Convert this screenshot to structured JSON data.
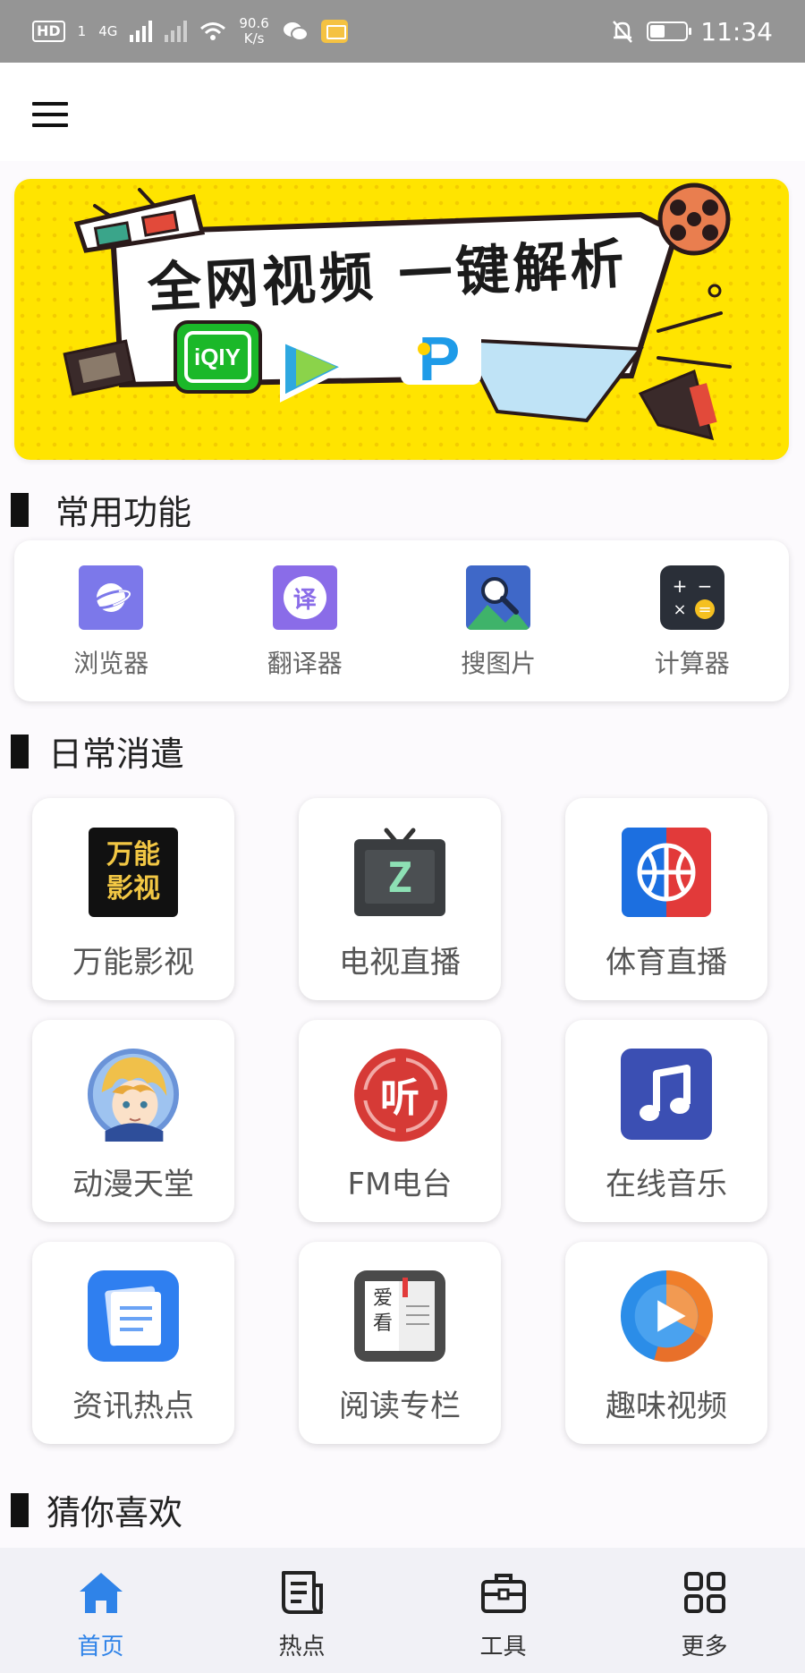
{
  "status_bar": {
    "hd": "HD",
    "hd_sub": "1",
    "network": "4G",
    "speed_value": "90.6",
    "speed_unit": "K/s",
    "time": "11:34",
    "icons": [
      "hd-icon",
      "signal-icon",
      "wifi-icon",
      "wechat-icon",
      "mail-icon",
      "mute-bell-icon",
      "battery-icon"
    ]
  },
  "top_bar": {
    "menu_icon": "hamburger-menu-icon"
  },
  "banner": {
    "title": "全网视频 一键解析"
  },
  "sections": {
    "common": "常用功能",
    "daily": "日常消遣",
    "guess": "猜你喜欢"
  },
  "common_functions": [
    {
      "label": "浏览器",
      "icon": "browser-icon"
    },
    {
      "label": "翻译器",
      "icon": "translate-icon",
      "glyph": "译"
    },
    {
      "label": "搜图片",
      "icon": "image-search-icon"
    },
    {
      "label": "计算器",
      "icon": "calculator-icon"
    }
  ],
  "daily_apps": [
    {
      "label": "万能影视",
      "icon": "movie-app-icon",
      "glyph_top": "万能",
      "glyph_bottom": "影视"
    },
    {
      "label": "电视直播",
      "icon": "tv-icon",
      "glyph": "Z"
    },
    {
      "label": "体育直播",
      "icon": "basketball-icon"
    },
    {
      "label": "动漫天堂",
      "icon": "anime-avatar-icon"
    },
    {
      "label": "FM电台",
      "icon": "fm-radio-icon",
      "glyph": "听"
    },
    {
      "label": "在线音乐",
      "icon": "music-note-icon"
    },
    {
      "label": "资讯热点",
      "icon": "news-icon"
    },
    {
      "label": "阅读专栏",
      "icon": "book-icon",
      "glyph_top": "爱",
      "glyph_bottom": "看"
    },
    {
      "label": "趣味视频",
      "icon": "play-video-icon"
    }
  ],
  "bottom_nav": [
    {
      "label": "首页",
      "icon": "home-icon",
      "active": true
    },
    {
      "label": "热点",
      "icon": "news-document-icon",
      "active": false
    },
    {
      "label": "工具",
      "icon": "toolbox-icon",
      "active": false
    },
    {
      "label": "更多",
      "icon": "grid-icon",
      "active": false
    }
  ],
  "colors": {
    "accent": "#2f83e8",
    "status_bar": "#959595",
    "banner_yellow": "#ffe400"
  }
}
